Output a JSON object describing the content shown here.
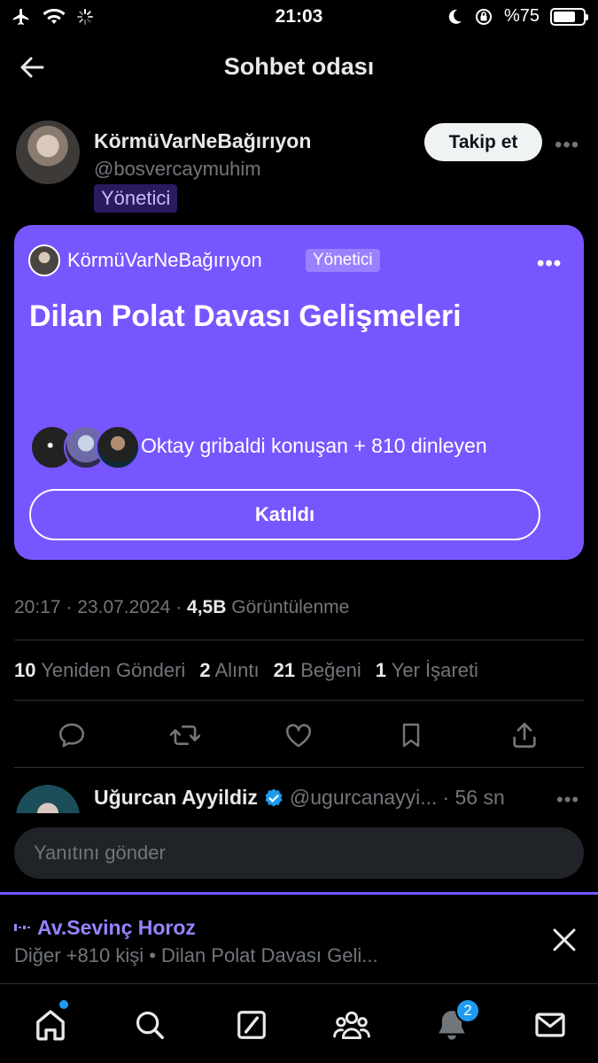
{
  "status_bar": {
    "time": "21:03",
    "battery_label": "%75",
    "battery_level": 0.75,
    "icons": [
      "airplane-icon",
      "wifi-icon",
      "loading-icon",
      "moon-icon",
      "orientation-lock-icon",
      "battery-icon"
    ]
  },
  "header": {
    "title": "Sohbet odası",
    "back_icon": "back-arrow-icon"
  },
  "post": {
    "author_name": "KörmüVarNeBağırıyon",
    "author_handle": "@bosvercaymuhim",
    "author_role": "Yönetici",
    "follow_label": "Takip et",
    "more_label": "•••"
  },
  "space_card": {
    "host_name": "KörmüVarNeBağırıyon",
    "host_role": "Yönetici",
    "more_label": "•••",
    "title": "Dilan Polat Davası Gelişmeleri",
    "listeners_text": "Oktay gribaldi konuşan + 810 dinleyen",
    "joined_label": "Katıldı",
    "color": "#7856ff"
  },
  "meta": {
    "time": "20:17",
    "sep1": "·",
    "date": "23.07.2024",
    "sep2": "·",
    "views_count": "4,5B",
    "views_label": "Görüntülenme"
  },
  "stats": [
    {
      "count": "10",
      "label": "Yeniden Gönderi"
    },
    {
      "count": "2",
      "label": "Alıntı"
    },
    {
      "count": "21",
      "label": "Beğeni"
    },
    {
      "count": "1",
      "label": "Yer İşareti"
    }
  ],
  "actions": [
    "reply-icon",
    "repost-icon",
    "like-icon",
    "bookmark-icon",
    "share-icon"
  ],
  "reply_preview": {
    "name": "Uğurcan Ayyildiz",
    "handle": "@ugurcanayyi...",
    "time": "· 56 sn",
    "more_label": "•••"
  },
  "composer": {
    "placeholder": "Yanıtını gönder"
  },
  "now_playing": {
    "speaker": "Av.Sevinç Horoz",
    "subtitle": "Diğer +810 kişi • Dilan Polat Davası Geli...",
    "accent": "#9a82ff"
  },
  "tab_bar": {
    "tabs": [
      "home-icon",
      "search-icon",
      "grok-icon",
      "communities-icon",
      "notifications-icon",
      "messages-icon"
    ],
    "notifications_badge": "2"
  }
}
